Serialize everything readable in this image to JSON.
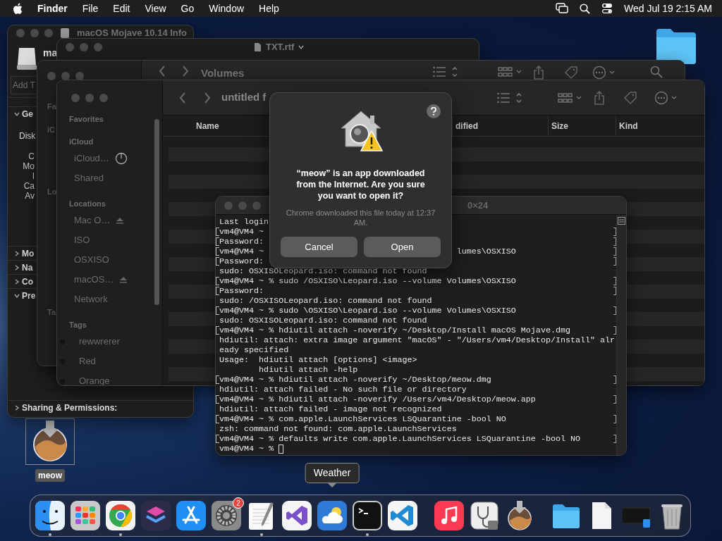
{
  "menu_bar": {
    "app": "Finder",
    "menus": [
      "File",
      "Edit",
      "View",
      "Go",
      "Window",
      "Help"
    ],
    "clock": "Wed Jul 19  2:15 AM"
  },
  "info_window": {
    "title": "macOS Mojave 10.14 Info",
    "name": "ma",
    "tags_placeholder": "Add T",
    "sections": [
      {
        "label": "Ge",
        "expanded": true,
        "rows": [
          {
            "label": "Disk",
            "kind": "heading"
          },
          {
            "label": "C",
            "kind": "field"
          },
          {
            "label": "Mo",
            "kind": "field"
          },
          {
            "label": "I",
            "kind": "field"
          },
          {
            "label": "Ca",
            "kind": "field"
          },
          {
            "label": "Av",
            "kind": "field"
          }
        ]
      },
      {
        "label": "Mo",
        "expanded": false
      },
      {
        "label": "Na",
        "expanded": false
      },
      {
        "label": "Co",
        "expanded": false
      },
      {
        "label": "Pre",
        "expanded": true
      },
      {
        "label": "Sharing & Permissions:",
        "expanded": false
      }
    ]
  },
  "document_window": {
    "title": "TXT.rtf"
  },
  "volumes_window": {
    "title": "Volumes",
    "sidebar_fragments": [
      "Fa",
      "iC",
      "Lo",
      "Ta"
    ]
  },
  "finder_window": {
    "title": "untitled f",
    "columns": [
      "Name",
      "dified",
      "Size",
      "Kind"
    ],
    "sidebar": [
      {
        "heading": "Favorites"
      },
      {
        "heading": "iCloud",
        "items": [
          {
            "label": "iCloud…",
            "kind": "syncing"
          },
          {
            "label": "Shared",
            "kind": "plain"
          }
        ]
      },
      {
        "heading": "Locations",
        "items": [
          {
            "label": "Mac O…",
            "kind": "ejectable"
          },
          {
            "label": "ISO",
            "kind": "plain"
          },
          {
            "label": "OSXISO",
            "kind": "plain"
          },
          {
            "label": "macOS…",
            "kind": "ejectable"
          },
          {
            "label": "Network",
            "kind": "plain"
          }
        ]
      },
      {
        "heading": "Tags",
        "items": [
          {
            "label": "rewwrerer",
            "kind": "tag"
          },
          {
            "label": "Red",
            "kind": "tag"
          },
          {
            "label": "Orange",
            "kind": "tag"
          }
        ]
      }
    ]
  },
  "terminal": {
    "title": "0×24",
    "lines": [
      {
        "text": "Last login",
        "marked": false
      },
      {
        "text": "vm4@VM4 ~",
        "marked": true
      },
      {
        "text": "Password:",
        "marked": true
      },
      {
        "text": "vm4@VM4 ~",
        "marked": true,
        "tail": {
          "text": "lumes\\OSXISO"
        }
      },
      {
        "text": "Password:",
        "marked": true
      },
      {
        "text": "sudo: OSXISOLeopard.iso: command not found",
        "marked": false
      },
      {
        "text": "vm4@VM4 ~ % sudo /OSXISO\\Leopard.iso --volume Volumes\\OSXISO",
        "marked": true
      },
      {
        "text": "Password:",
        "marked": true
      },
      {
        "text": "sudo: /OSXISOLeopard.iso: command not found",
        "marked": false
      },
      {
        "text": "vm4@VM4 ~ % sudo \\OSXISO\\Leopard.iso --volume Volumes\\OSXISO",
        "marked": true
      },
      {
        "text": "sudo: OSXISOLeopard.iso: command not found",
        "marked": false
      },
      {
        "text": "vm4@VM4 ~ % hdiutil attach -noverify ~/Desktop/Install macOS Mojave.dmg",
        "marked": true
      },
      {
        "text": "hdiutil: attach: extra image argument \"macOS\" - \"/Users/vm4/Desktop/Install\" alr",
        "marked": false
      },
      {
        "text": "eady specified",
        "marked": false
      },
      {
        "text": "Usage:  hdiutil attach [options] <image>",
        "marked": false
      },
      {
        "text": "        hdiutil attach -help",
        "marked": false
      },
      {
        "text": "vm4@VM4 ~ % hdiutil attach -noverify ~/Desktop/meow.dmg",
        "marked": true
      },
      {
        "text": "hdiutil: attach failed - No such file or directory",
        "marked": false
      },
      {
        "text": "vm4@VM4 ~ % hdiutil attach -noverify /Users/vm4/Desktop/meow.app",
        "marked": true
      },
      {
        "text": "hdiutil: attach failed - image not recognized",
        "marked": false
      },
      {
        "text": "vm4@VM4 ~ % com.apple.LaunchServices LSQuarantine -bool NO",
        "marked": true
      },
      {
        "text": "zsh: command not found: com.apple.LaunchServices",
        "marked": false
      },
      {
        "text": "vm4@VM4 ~ % defaults write com.apple.LaunchServices LSQuarantine -bool NO",
        "marked": true
      },
      {
        "text": "vm4@VM4 ~ %",
        "marked": false,
        "cursor": true
      }
    ]
  },
  "dialog": {
    "title": "“meow” is an app downloaded from the Internet. Are you sure you want to open it?",
    "message": "Chrome downloaded this file today at 12:37 AM.",
    "buttons": [
      "Cancel",
      "Open"
    ]
  },
  "desktop": {
    "file_label": "meow"
  },
  "dock": {
    "tooltip": "Weather",
    "items": [
      {
        "kind": "finder",
        "running": true
      },
      {
        "kind": "launchpad",
        "running": false
      },
      {
        "kind": "chrome",
        "running": true
      },
      {
        "kind": "shortcuts",
        "running": false
      },
      {
        "kind": "appstore",
        "running": false
      },
      {
        "kind": "settings",
        "running": false,
        "badge": "2"
      },
      {
        "kind": "textedit",
        "running": true
      },
      {
        "kind": "vstudio",
        "running": false
      },
      {
        "kind": "weather",
        "running": false,
        "hovered": true
      },
      {
        "kind": "terminal",
        "running": true
      },
      {
        "kind": "vscode",
        "running": false
      },
      {
        "kind": "separator"
      },
      {
        "kind": "music",
        "running": false
      },
      {
        "kind": "diskutil",
        "running": false
      },
      {
        "kind": "installer",
        "running": false
      },
      {
        "kind": "separator"
      },
      {
        "kind": "folder",
        "running": false
      },
      {
        "kind": "document",
        "running": false
      },
      {
        "kind": "thumbnail",
        "running": false
      },
      {
        "kind": "trash",
        "running": false
      }
    ]
  }
}
